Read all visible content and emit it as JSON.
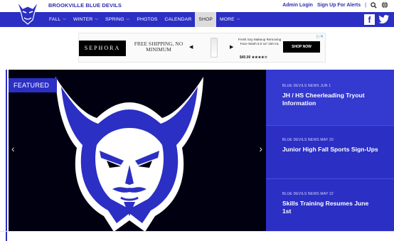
{
  "site": {
    "name": "BROOKVILLE BLUE DEVILS"
  },
  "top_links": {
    "admin_login": "Admin Login",
    "sign_up": "Sign Up For Alerts",
    "separator": "|"
  },
  "nav": {
    "items": [
      {
        "label": "FALL",
        "has_dropdown": true
      },
      {
        "label": "WINTER",
        "has_dropdown": true
      },
      {
        "label": "SPRING",
        "has_dropdown": true
      },
      {
        "label": "PHOTOS",
        "has_dropdown": false
      },
      {
        "label": "CALENDAR",
        "has_dropdown": false
      },
      {
        "label": "SHOP",
        "has_dropdown": false,
        "active": true
      },
      {
        "label": "MORE",
        "has_dropdown": true
      }
    ],
    "social": [
      "facebook-icon",
      "twitter-icon"
    ]
  },
  "ad": {
    "brand": "SEPHORA",
    "offer": "FREE SHIPPING, NO MINIMUM",
    "product": "Fresh Soy Makeup Removing Face Wash 5.0 oz/ 150 mL",
    "price": "$40.00",
    "rating": "★★★★☆",
    "cta": "SHOP NOW"
  },
  "featured": {
    "tag": "FEATURED"
  },
  "news": [
    {
      "meta": "BLUE DEVILS NEWS  JUN 1",
      "title": "JH / HS Cheerleading Tryout Information"
    },
    {
      "meta": "BLUE DEVILS NEWS  MAY 20",
      "title": "Junior High Fall Sports Sign-Ups"
    },
    {
      "meta": "BLUE DEVILS NEWS  MAY 22",
      "title": "Skills Training Resumes June 1st"
    }
  ],
  "colors": {
    "brand_blue": "#2b2fc4",
    "featured_bg": "#000010",
    "white": "#ffffff"
  }
}
